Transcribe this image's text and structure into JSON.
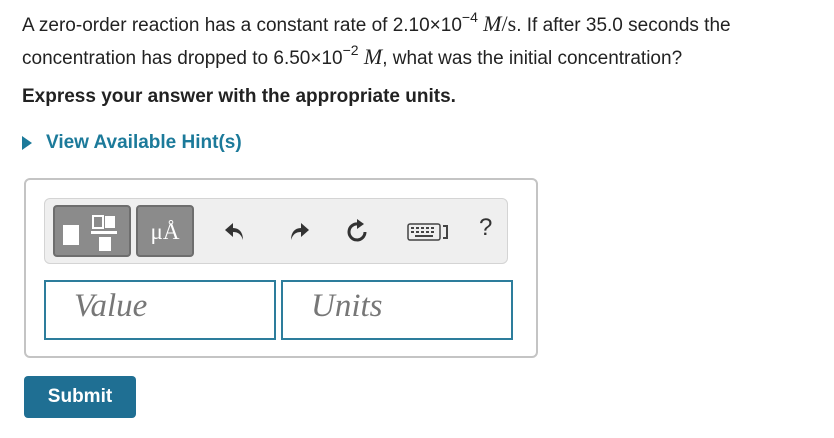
{
  "question": {
    "part1": "A zero-order reaction has a constant rate of 2.10×10",
    "exp1": "−4",
    "unit1_var": "M",
    "unit1_rest": "/s",
    "part2": ". If after 35.0 seconds the concentration has dropped to 6.50×10",
    "exp2": "−2",
    "unit2_var": "M",
    "part3": ", what was the initial concentration?"
  },
  "instruction": "Express your answer with the appropriate units.",
  "hint_link": "View Available Hint(s)",
  "toolbar": {
    "units_button": "μÅ",
    "help": "?",
    "icons": [
      "fraction-template-icon",
      "units-icon",
      "undo-icon",
      "redo-icon",
      "reset-icon",
      "keyboard-icon",
      "help-icon"
    ]
  },
  "inputs": {
    "value_placeholder": "Value",
    "units_placeholder": "Units"
  },
  "submit_label": "Submit",
  "colors": {
    "accent": "#1c7a9a",
    "submit": "#1f6f93",
    "field_border": "#2d7d9c",
    "toolbar_bg": "#efefef"
  }
}
